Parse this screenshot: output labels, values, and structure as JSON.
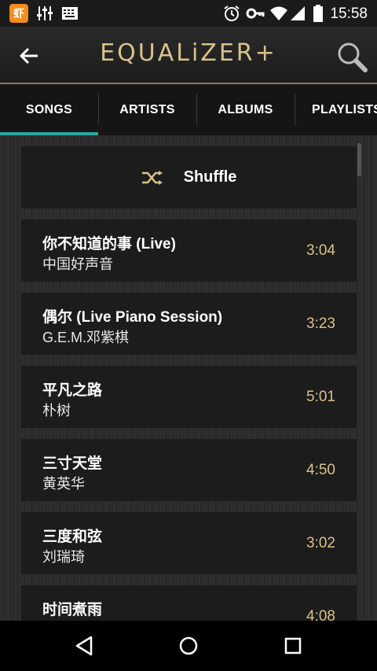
{
  "status_bar": {
    "app_icon_text": "虾",
    "time": "15:58"
  },
  "header": {
    "title": "EQUALiZER+"
  },
  "tabs": [
    {
      "label": "SONGS"
    },
    {
      "label": "ARTISTS"
    },
    {
      "label": "ALBUMS"
    },
    {
      "label": "PLAYLISTS"
    }
  ],
  "shuffle": {
    "label": "Shuffle"
  },
  "songs": [
    {
      "title": "你不知道的事 (Live)",
      "artist": "中国好声音",
      "duration": "3:04"
    },
    {
      "title": "偶尔 (Live Piano Session)",
      "artist": "G.E.M.邓紫棋",
      "duration": "3:23"
    },
    {
      "title": "平凡之路",
      "artist": "朴树",
      "duration": "5:01"
    },
    {
      "title": "三寸天堂",
      "artist": "黄英华",
      "duration": "4:50"
    },
    {
      "title": "三度和弦",
      "artist": "刘瑞琦",
      "duration": "3:02"
    },
    {
      "title": "时间煮雨",
      "artist": "",
      "duration": "4:08"
    }
  ],
  "colors": {
    "accent_gold": "#d8c28a",
    "tab_indicator": "#2aa6a0"
  }
}
